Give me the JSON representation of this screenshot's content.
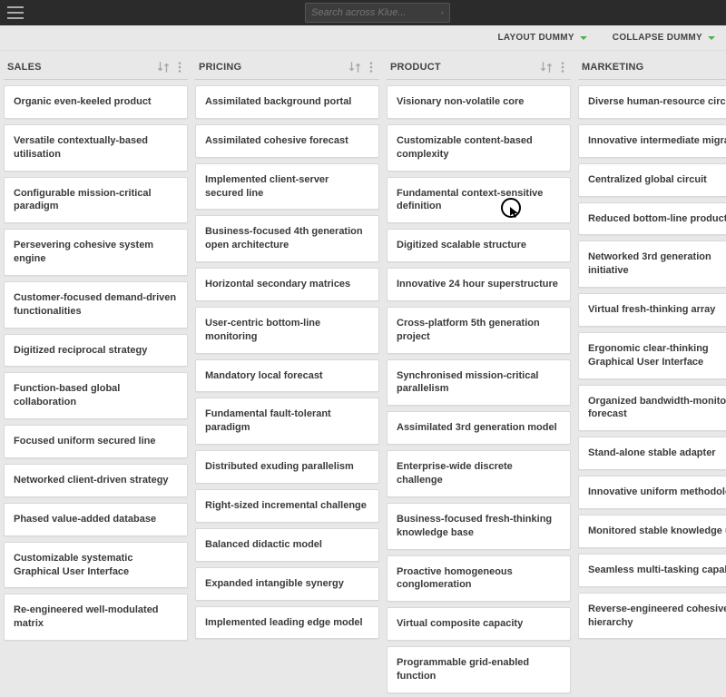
{
  "search": {
    "placeholder": "Search across Klue..."
  },
  "toolbar": {
    "layout_label": "LAYOUT DUMMY",
    "collapse_label": "COLLAPSE DUMMY"
  },
  "columns": [
    {
      "title": "SALES",
      "cards": [
        "Organic even-keeled product",
        "Versatile contextually-based utilisation",
        "Configurable mission-critical paradigm",
        "Persevering cohesive system engine",
        "Customer-focused demand-driven functionalities",
        "Digitized reciprocal strategy",
        "Function-based global collaboration",
        "Focused uniform secured line",
        "Networked client-driven strategy",
        "Phased value-added database",
        "Customizable systematic Graphical User Interface",
        "Re-engineered well-modulated matrix"
      ]
    },
    {
      "title": "PRICING",
      "cards": [
        "Assimilated background portal",
        "Assimilated cohesive forecast",
        "Implemented client-server secured line",
        "Business-focused 4th generation open architecture",
        "Horizontal secondary matrices",
        "User-centric bottom-line monitoring",
        "Mandatory local forecast",
        "Fundamental fault-tolerant paradigm",
        "Distributed exuding parallelism",
        "Right-sized incremental challenge",
        "Balanced didactic model",
        "Expanded intangible synergy",
        "Implemented leading edge model"
      ]
    },
    {
      "title": "PRODUCT",
      "cards": [
        "Visionary non-volatile core",
        "Customizable content-based complexity",
        "Fundamental context-sensitive definition",
        "Digitized scalable structure",
        "Innovative 24 hour superstructure",
        "Cross-platform 5th generation project",
        "Synchronised mission-critical parallelism",
        "Assimilated 3rd generation model",
        "Enterprise-wide discrete challenge",
        "Business-focused fresh-thinking knowledge base",
        "Proactive homogeneous conglomeration",
        "Virtual composite capacity",
        "Programmable grid-enabled function"
      ]
    },
    {
      "title": "MARKETING",
      "cards": [
        "Diverse human-resource circuit",
        "Innovative intermediate migration",
        "Centralized global circuit",
        "Reduced bottom-line productivity",
        "Networked 3rd generation initiative",
        "Virtual fresh-thinking array",
        "Ergonomic clear-thinking Graphical User Interface",
        "Organized bandwidth-monitored forecast",
        "Stand-alone stable adapter",
        "Innovative uniform methodology",
        "Monitored stable knowledge user",
        "Seamless multi-tasking capability",
        "Reverse-engineered cohesive hierarchy"
      ]
    }
  ]
}
